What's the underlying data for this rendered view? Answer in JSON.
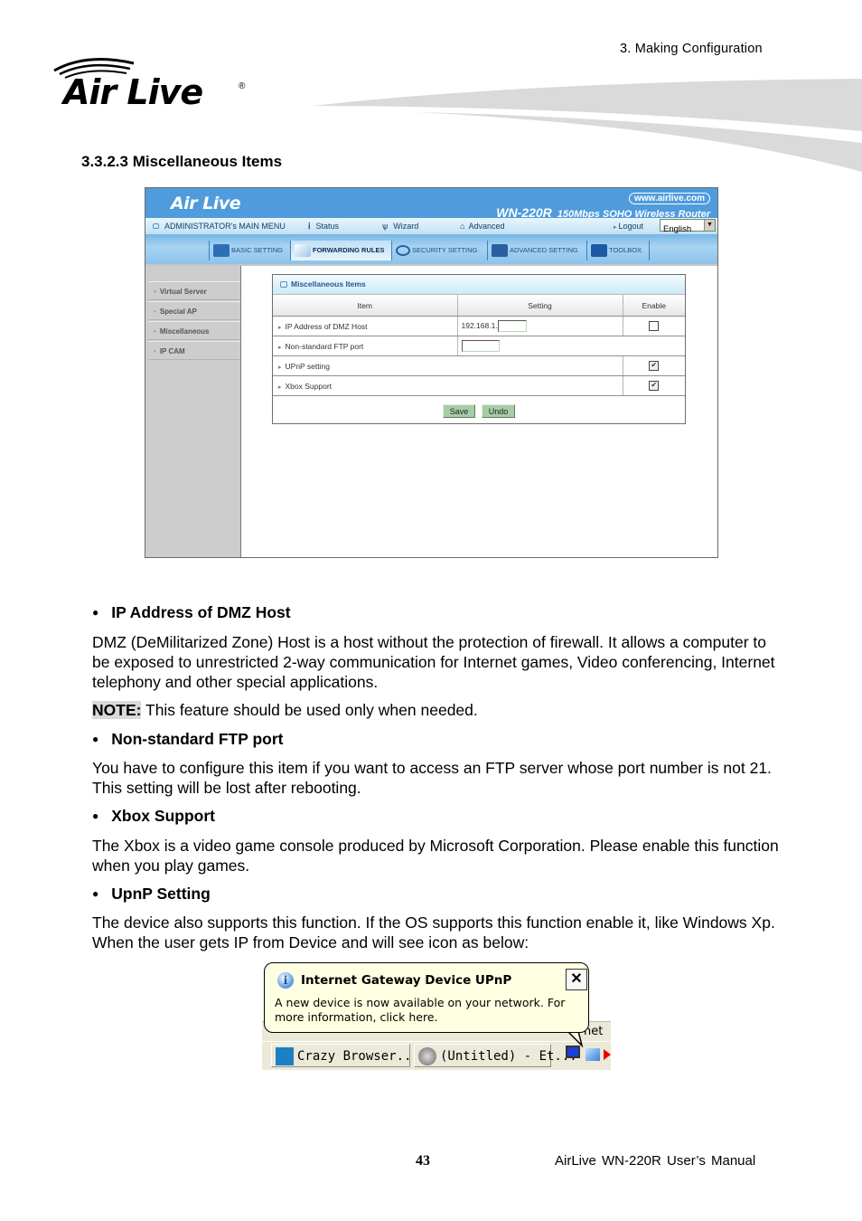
{
  "header": {
    "chapter": "3.  Making  Configuration",
    "logo_text": "Air Live",
    "logo_mark": "®"
  },
  "section": {
    "title": "3.3.2.3  Miscellaneous Items"
  },
  "router_ui": {
    "logo": "Air Live",
    "url": "www.airlive.com",
    "model": "WN-220R",
    "model_desc": "150Mbps SOHO Wireless Router",
    "menu": {
      "main": "ADMINISTRATOR's MAIN MENU",
      "status": "Status",
      "wizard": "Wizard",
      "advanced": "Advanced",
      "logout": "Logout",
      "language": "English"
    },
    "tabs": [
      {
        "label": "BASIC SETTING",
        "icon": "folder-icon",
        "active": false
      },
      {
        "label": "FORWARDING RULES",
        "icon": "forwarding-icon",
        "active": true
      },
      {
        "label": "SECURITY SETTING",
        "icon": "security-icon",
        "active": false
      },
      {
        "label": "ADVANCED SETTING",
        "icon": "advanced-icon",
        "active": false
      },
      {
        "label": "TOOLBOX",
        "icon": "toolbox-icon",
        "active": false
      }
    ],
    "sidebar": [
      {
        "label": "Virtual Server"
      },
      {
        "label": "Special AP"
      },
      {
        "label": "Miscellaneous"
      },
      {
        "label": "IP CAM"
      }
    ],
    "panel": {
      "title": "Miscellaneous Items",
      "columns": [
        "Item",
        "Setting",
        "Enable"
      ],
      "rows": [
        {
          "item": "IP Address of DMZ Host",
          "setting_prefix": "192.168.1.",
          "setting_value": "",
          "enable": false
        },
        {
          "item": "Non-standard FTP port",
          "setting_value": ""
        },
        {
          "item": "UPnP setting",
          "enable": true
        },
        {
          "item": "Xbox Support",
          "enable": true
        }
      ],
      "save_label": "Save",
      "undo_label": "Undo"
    }
  },
  "content": {
    "dmz": {
      "heading": "IP Address of DMZ Host",
      "body": "DMZ (DeMilitarized Zone) Host is a host without the protection of firewall. It allows a computer to be exposed to unrestricted 2-way communication for Internet games, Video conferencing, Internet telephony and other special applications.",
      "note_label": "NOTE:",
      "note_text": " This feature should be used only when needed."
    },
    "ftp": {
      "heading": "Non-standard FTP port",
      "body": "You have to configure this item if you want to access an FTP server whose port number is not 21. This setting will be lost after rebooting."
    },
    "xbox": {
      "heading": "Xbox Support",
      "body": "The Xbox is a video game console produced by Microsoft Corporation. Please enable this function when you play games."
    },
    "upnp": {
      "heading": "UpnP Setting",
      "body": "The device also supports this function. If the OS supports this function enable it, like Windows Xp. When the user gets IP from Device and will see icon as below:"
    }
  },
  "xp_balloon": {
    "title": "Internet Gateway Device UPnP",
    "message": "A new device is now available on your network. For more information, click here.",
    "close": "✕",
    "taskbar_partial": "net",
    "tasks": [
      {
        "label": "Crazy Browser..."
      },
      {
        "label": "(Untitled) - Et..."
      }
    ]
  },
  "footer": {
    "page_number": "43",
    "manual_title": "AirLive  WN-220R  User’s  Manual"
  }
}
